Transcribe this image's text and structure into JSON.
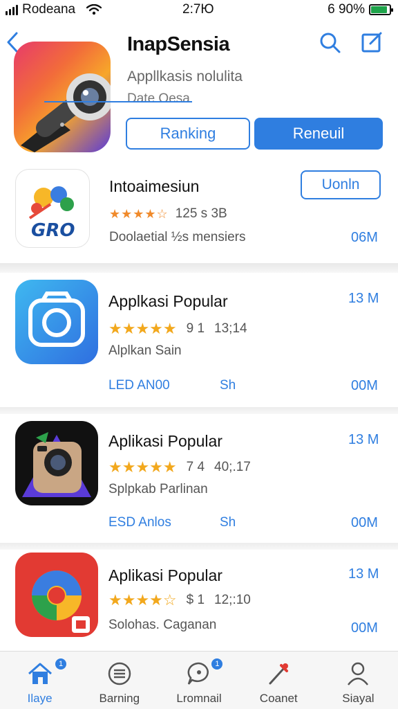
{
  "status_bar": {
    "carrier": "Rodeana",
    "time": "2:7Ю",
    "battery_text": "6 90%",
    "battery_level": 0.9
  },
  "header": {
    "title": "InapSensia",
    "subtitle": "Appllkasis nolulita",
    "meta": "Date Oesa",
    "primary_button": "Ranking",
    "secondary_button": "Reneuil"
  },
  "featured": {
    "title": "Intoaimesiun",
    "rating": "125 s 3B",
    "description": "Doolaetial ½s mensiers",
    "button": "Uonln",
    "size": "06M"
  },
  "apps": [
    {
      "name": "Applkasi Popular",
      "rating_value": "9 1",
      "rating_count": "13;14",
      "description": "Alplkan Sain",
      "size_top": "13 M",
      "link_a": "LED AN00",
      "link_b": "Sh",
      "size_bottom": "00M"
    },
    {
      "name": "Aplikasi Popular",
      "rating_value": "7 4",
      "rating_count": "40;.17",
      "description": "Splpkab Parlinan",
      "size_top": "13 M",
      "link_a": "ESD Anlos",
      "link_b": "Sh",
      "size_bottom": "00M"
    },
    {
      "name": "Aplikasi Popular",
      "rating_value": "$ 1",
      "rating_count": "12;:10",
      "description": "Solohas. Caganan",
      "size_top": "13 M",
      "size_bottom": "00M"
    }
  ],
  "tabs": [
    {
      "label": "Ilaye",
      "icon": "home-icon",
      "badge": "1"
    },
    {
      "label": "Barning",
      "icon": "list-icon"
    },
    {
      "label": "Lromnail",
      "icon": "chat-icon",
      "badge": "1"
    },
    {
      "label": "Coanet",
      "icon": "tools-icon"
    },
    {
      "label": "Siayal",
      "icon": "profile-icon"
    }
  ],
  "colors": {
    "accent": "#2f7ee0",
    "star": "#f2a81d",
    "battery": "#1ea34a"
  }
}
